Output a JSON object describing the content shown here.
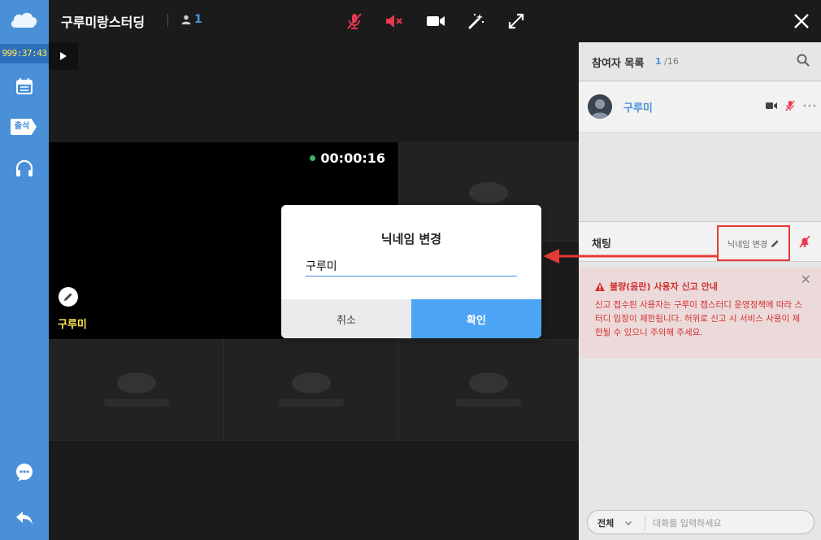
{
  "sidebar": {
    "timer": "999:37:43",
    "attend_label": "출석",
    "icons": [
      "cloud-logo-icon",
      "calendar-icon",
      "attend-tag-icon",
      "headphones-icon",
      "chat-bubble-icon",
      "back-arrow-icon"
    ]
  },
  "topbar": {
    "room_title": "구루미랑스터딩",
    "user_count": "1",
    "icons": [
      "mic-muted-icon",
      "speaker-muted-icon",
      "camera-icon",
      "magic-wand-icon",
      "fullscreen-icon",
      "close-icon"
    ]
  },
  "video": {
    "recording_time": "00:00:16",
    "user_name": "구루미"
  },
  "participants": {
    "title": "참여자 목록",
    "count_current": "1",
    "count_total": "/16",
    "items": [
      {
        "name": "구루미"
      }
    ]
  },
  "chat": {
    "title": "채팅",
    "nickname_button": "닉네임 변경",
    "notice_title": "불량(음란) 사용자 신고 안내",
    "notice_body": "신고 접수된 사용자는 구루미 캠스터디 운영정책에 따라 스터디 입장이 제한됩니다. 허위로 신고 시 서비스 사용이 제한될 수 있으니 주의해 주세요.",
    "scope": "전체",
    "input_placeholder": "대화를 입력하세요"
  },
  "modal": {
    "title": "닉네임 변경",
    "input_value": "구루미",
    "cancel_label": "취소",
    "confirm_label": "확인"
  },
  "colors": {
    "sidebar": "#4a90d9",
    "accent_blue": "#4da3f4",
    "alert_red": "#e53935",
    "timer_yellow": "#ffe94d"
  }
}
